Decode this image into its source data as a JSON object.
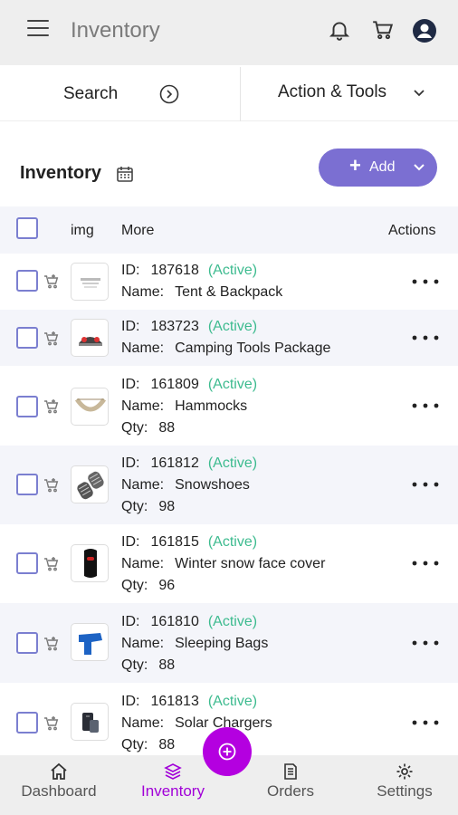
{
  "appbar": {
    "title": "Inventory"
  },
  "searchbar": {
    "search_label": "Search",
    "actions_label": "Action & Tools"
  },
  "header": {
    "title": "Inventory",
    "add_label": "Add"
  },
  "table": {
    "columns": {
      "img": "img",
      "more": "More",
      "actions": "Actions"
    },
    "labels": {
      "id": "ID:",
      "name": "Name:",
      "qty": "Qty:"
    },
    "rows": [
      {
        "id": "187618",
        "status": "(Active)",
        "name": "Tent & Backpack",
        "qty": ""
      },
      {
        "id": "183723",
        "status": "(Active)",
        "name": "Camping Tools Package",
        "qty": ""
      },
      {
        "id": "161809",
        "status": "(Active)",
        "name": "Hammocks",
        "qty": "88"
      },
      {
        "id": "161812",
        "status": "(Active)",
        "name": "Snowshoes",
        "qty": "98"
      },
      {
        "id": "161815",
        "status": "(Active)",
        "name": "Winter snow face cover",
        "qty": "96"
      },
      {
        "id": "161810",
        "status": "(Active)",
        "name": "Sleeping Bags",
        "qty": "88"
      },
      {
        "id": "161813",
        "status": "(Active)",
        "name": "Solar Chargers",
        "qty": "88"
      }
    ]
  },
  "bottom_nav": {
    "dashboard": "Dashboard",
    "inventory": "Inventory",
    "orders": "Orders",
    "settings": "Settings",
    "active": "inventory"
  },
  "colors": {
    "accent": "#7b6fd2",
    "fab": "#b400e0",
    "active_tab": "#a100d8",
    "status": "#3dbb8f"
  }
}
